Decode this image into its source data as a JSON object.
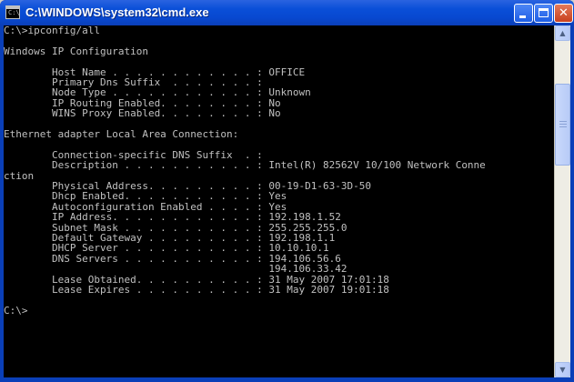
{
  "window": {
    "title": "C:\\WINDOWS\\system32\\cmd.exe",
    "icon_text": "C:\\",
    "minimize_icon": "minimize-icon",
    "maximize_icon": "maximize-icon",
    "close_glyph": "✕"
  },
  "console": {
    "lines": [
      "C:\\>ipconfig/all",
      "",
      "Windows IP Configuration",
      "",
      "        Host Name . . . . . . . . . . . . : OFFICE",
      "        Primary Dns Suffix  . . . . . . . :",
      "        Node Type . . . . . . . . . . . . : Unknown",
      "        IP Routing Enabled. . . . . . . . : No",
      "        WINS Proxy Enabled. . . . . . . . : No",
      "",
      "Ethernet adapter Local Area Connection:",
      "",
      "        Connection-specific DNS Suffix  . :",
      "        Description . . . . . . . . . . . : Intel(R) 82562V 10/100 Network Conne",
      "ction",
      "        Physical Address. . . . . . . . . : 00-19-D1-63-3D-50",
      "        Dhcp Enabled. . . . . . . . . . . : Yes",
      "        Autoconfiguration Enabled . . . . : Yes",
      "        IP Address. . . . . . . . . . . . : 192.198.1.52",
      "        Subnet Mask . . . . . . . . . . . : 255.255.255.0",
      "        Default Gateway . . . . . . . . . : 192.198.1.1",
      "        DHCP Server . . . . . . . . . . . : 10.10.10.1",
      "        DNS Servers . . . . . . . . . . . : 194.106.56.6",
      "                                            194.106.33.42",
      "        Lease Obtained. . . . . . . . . . : 31 May 2007 17:01:18",
      "        Lease Expires . . . . . . . . . . : 31 May 2007 19:01:18",
      "",
      "C:\\>"
    ]
  },
  "scrollbar": {
    "up_icon": "▲",
    "down_icon": "▼"
  }
}
